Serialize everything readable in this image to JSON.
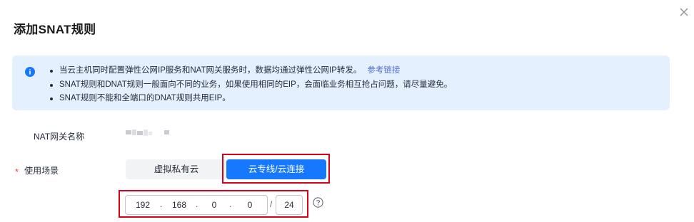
{
  "dialog": {
    "title": "添加SNAT规则"
  },
  "notice": {
    "items": [
      "当云主机同时配置弹性公网IP服务和NAT网关服务时，数据均通过弹性公网IP转发。",
      "SNAT规则和DNAT规则一般面向不同的业务，如果使用相同的EIP，会面临业务相互抢占问题，请尽量避免。",
      "SNAT规则不能和全端口的DNAT规则共用EIP。"
    ],
    "link": "参考链接"
  },
  "form": {
    "gateway_label": "NAT网关名称",
    "scenario": {
      "required_mark": "*",
      "label": "使用场景",
      "options": [
        "虚拟私有云",
        "云专线/云连接"
      ],
      "selected": "云专线/云连接"
    },
    "cidr": {
      "octets": [
        "192",
        "168",
        "0",
        "0"
      ],
      "separator": ".",
      "slash": "/",
      "mask": "24"
    }
  },
  "colors": {
    "accent": "#1677ff",
    "notice_bg": "#e5f0ff",
    "highlight": "#d9001b",
    "required": "#e54545"
  },
  "icons": [
    "close-icon",
    "info-icon",
    "help-icon"
  ]
}
